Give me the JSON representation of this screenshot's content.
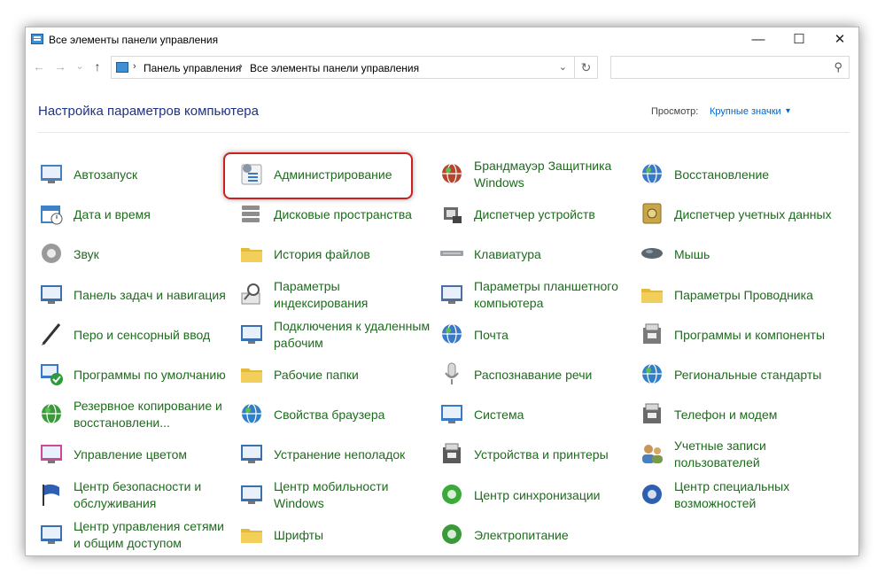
{
  "window": {
    "title": "Все элементы панели управления",
    "minimize_glyph": "—",
    "maximize_glyph": "☐",
    "close_glyph": "✕"
  },
  "address_bar": {
    "back_glyph": "←",
    "forward_glyph": "→",
    "recent_glyph": "⌄",
    "up_glyph": "↑",
    "separator": "›",
    "crumbs": [
      "Панель управления",
      "Все элементы панели управления"
    ],
    "dropdown_glyph": "⌄",
    "refresh_glyph": "↻",
    "search_glyph": "⚲",
    "search_placeholder": ""
  },
  "header": {
    "title": "Настройка параметров компьютера",
    "view_label": "Просмотр:",
    "view_value": "Крупные значки",
    "view_caret": "▾"
  },
  "items": [
    {
      "label": "Автозапуск",
      "icon": "autoplay-icon",
      "color": "#4a7fbf"
    },
    {
      "label": "Администрирование",
      "icon": "admin-tools-icon",
      "color": "#8a96a6"
    },
    {
      "label": "Брандмауэр Защитника Windows",
      "icon": "firewall-icon",
      "color": "#b5452e"
    },
    {
      "label": "Восстановление",
      "icon": "recovery-icon",
      "color": "#3a78c8"
    },
    {
      "label": "Дата и время",
      "icon": "date-time-icon",
      "color": "#3d82c9"
    },
    {
      "label": "Дисковые пространства",
      "icon": "storage-spaces-icon",
      "color": "#8d8d8d"
    },
    {
      "label": "Диспетчер устройств",
      "icon": "device-manager-icon",
      "color": "#6a6a6a"
    },
    {
      "label": "Диспетчер учетных данных",
      "icon": "credential-manager-icon",
      "color": "#c9a64a"
    },
    {
      "label": "Звук",
      "icon": "sound-icon",
      "color": "#9a9a9a"
    },
    {
      "label": "История файлов",
      "icon": "file-history-icon",
      "color": "#e3b93e"
    },
    {
      "label": "Клавиатура",
      "icon": "keyboard-icon",
      "color": "#9aa0a6"
    },
    {
      "label": "Мышь",
      "icon": "mouse-icon",
      "color": "#5a6570"
    },
    {
      "label": "Панель задач и навигация",
      "icon": "taskbar-icon",
      "color": "#3a6fb0"
    },
    {
      "label": "Параметры индексирования",
      "icon": "indexing-icon",
      "color": "#8a8a8a"
    },
    {
      "label": "Параметры планшетного компьютера",
      "icon": "tablet-icon",
      "color": "#4a6fa0"
    },
    {
      "label": "Параметры Проводника",
      "icon": "explorer-options-icon",
      "color": "#e3b93e"
    },
    {
      "label": "Перо и сенсорный ввод",
      "icon": "pen-icon",
      "color": "#333333"
    },
    {
      "label": "Подключения к удаленным рабочим",
      "icon": "remote-desktop-icon",
      "color": "#3a6fb0"
    },
    {
      "label": "Почта",
      "icon": "mail-icon",
      "color": "#3a78c8"
    },
    {
      "label": "Программы и компоненты",
      "icon": "programs-icon",
      "color": "#7a7a7a"
    },
    {
      "label": "Программы по умолчанию",
      "icon": "default-programs-icon",
      "color": "#2e9a3c"
    },
    {
      "label": "Рабочие папки",
      "icon": "work-folders-icon",
      "color": "#e3b93e"
    },
    {
      "label": "Распознавание речи",
      "icon": "speech-icon",
      "color": "#8a8a8a"
    },
    {
      "label": "Региональные стандарты",
      "icon": "region-icon",
      "color": "#2f7fc9"
    },
    {
      "label": "Резервное копирование и восстановлени...",
      "icon": "backup-icon",
      "color": "#3a9a3a"
    },
    {
      "label": "Свойства браузера",
      "icon": "internet-options-icon",
      "color": "#2f7fc9"
    },
    {
      "label": "Система",
      "icon": "system-icon",
      "color": "#3a78c8"
    },
    {
      "label": "Телефон и модем",
      "icon": "phone-modem-icon",
      "color": "#6a6a6a"
    },
    {
      "label": "Управление цветом",
      "icon": "color-management-icon",
      "color": "#c94a9a"
    },
    {
      "label": "Устранение неполадок",
      "icon": "troubleshooting-icon",
      "color": "#3a6fb0"
    },
    {
      "label": "Устройства и принтеры",
      "icon": "devices-printers-icon",
      "color": "#5a5a5a"
    },
    {
      "label": "Учетные записи пользователей",
      "icon": "user-accounts-icon",
      "color": "#4a7fbf"
    },
    {
      "label": "Центр безопасности и обслуживания",
      "icon": "security-flag-icon",
      "color": "#2f5fb0"
    },
    {
      "label": "Центр мобильности Windows",
      "icon": "mobility-center-icon",
      "color": "#3a6fb0"
    },
    {
      "label": "Центр синхронизации",
      "icon": "sync-center-icon",
      "color": "#3aaa3a"
    },
    {
      "label": "Центр специальных возможностей",
      "icon": "ease-of-access-icon",
      "color": "#2f5fb0"
    },
    {
      "label": "Центр управления сетями и общим доступом",
      "icon": "network-center-icon",
      "color": "#3a6fb0"
    },
    {
      "label": "Шрифты",
      "icon": "fonts-icon",
      "color": "#e3b93e"
    },
    {
      "label": "Электропитание",
      "icon": "power-options-icon",
      "color": "#3a9a3a"
    }
  ],
  "highlighted_item": "Администрирование"
}
